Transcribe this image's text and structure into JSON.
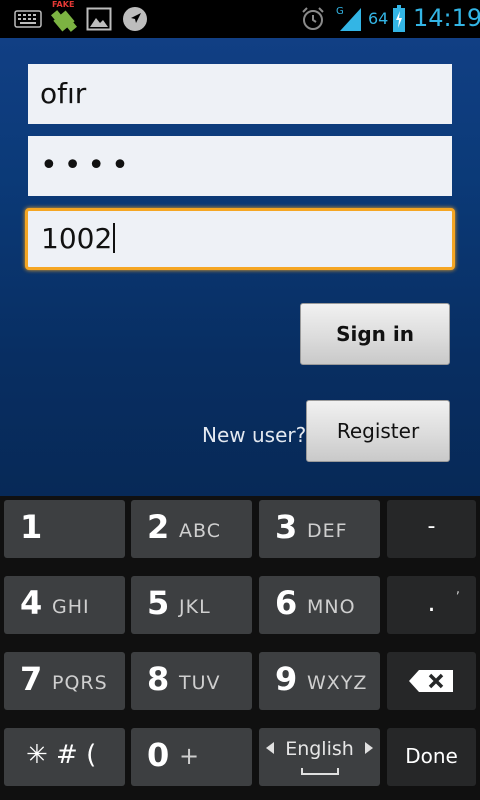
{
  "status_bar": {
    "fake_label": "FAKE",
    "battery_percent": "64",
    "network_type": "G",
    "time": "14:19",
    "icons": [
      "keyboard-icon",
      "fake-gps-icon",
      "image-icon",
      "navigation-icon",
      "alarm-icon",
      "signal-icon",
      "battery-charging-icon"
    ],
    "accent_color": "#33b5e5"
  },
  "login": {
    "username_value": "ofır",
    "password_value": "••••",
    "extension_value": "1002",
    "sign_in_label": "Sign in",
    "new_user_label": "New user?",
    "register_label": "Register",
    "focus_color": "#f5a623"
  },
  "keyboard": {
    "keys": [
      {
        "num": "1",
        "letters": ""
      },
      {
        "num": "2",
        "letters": "ABC"
      },
      {
        "num": "3",
        "letters": "DEF"
      },
      {
        "num": "-",
        "letters": ""
      },
      {
        "num": "4",
        "letters": "GHI"
      },
      {
        "num": "5",
        "letters": "JKL"
      },
      {
        "num": "6",
        "letters": "MNO"
      },
      {
        "num": ".",
        "letters": ","
      },
      {
        "num": "7",
        "letters": "PQRS"
      },
      {
        "num": "8",
        "letters": "TUV"
      },
      {
        "num": "9",
        "letters": "WXYZ"
      },
      {
        "num": "backspace",
        "letters": ""
      },
      {
        "num": "✳ # (",
        "letters": ""
      },
      {
        "num": "0",
        "letters": "+"
      },
      {
        "num": "English",
        "letters": ""
      },
      {
        "num": "Done",
        "letters": ""
      }
    ]
  }
}
